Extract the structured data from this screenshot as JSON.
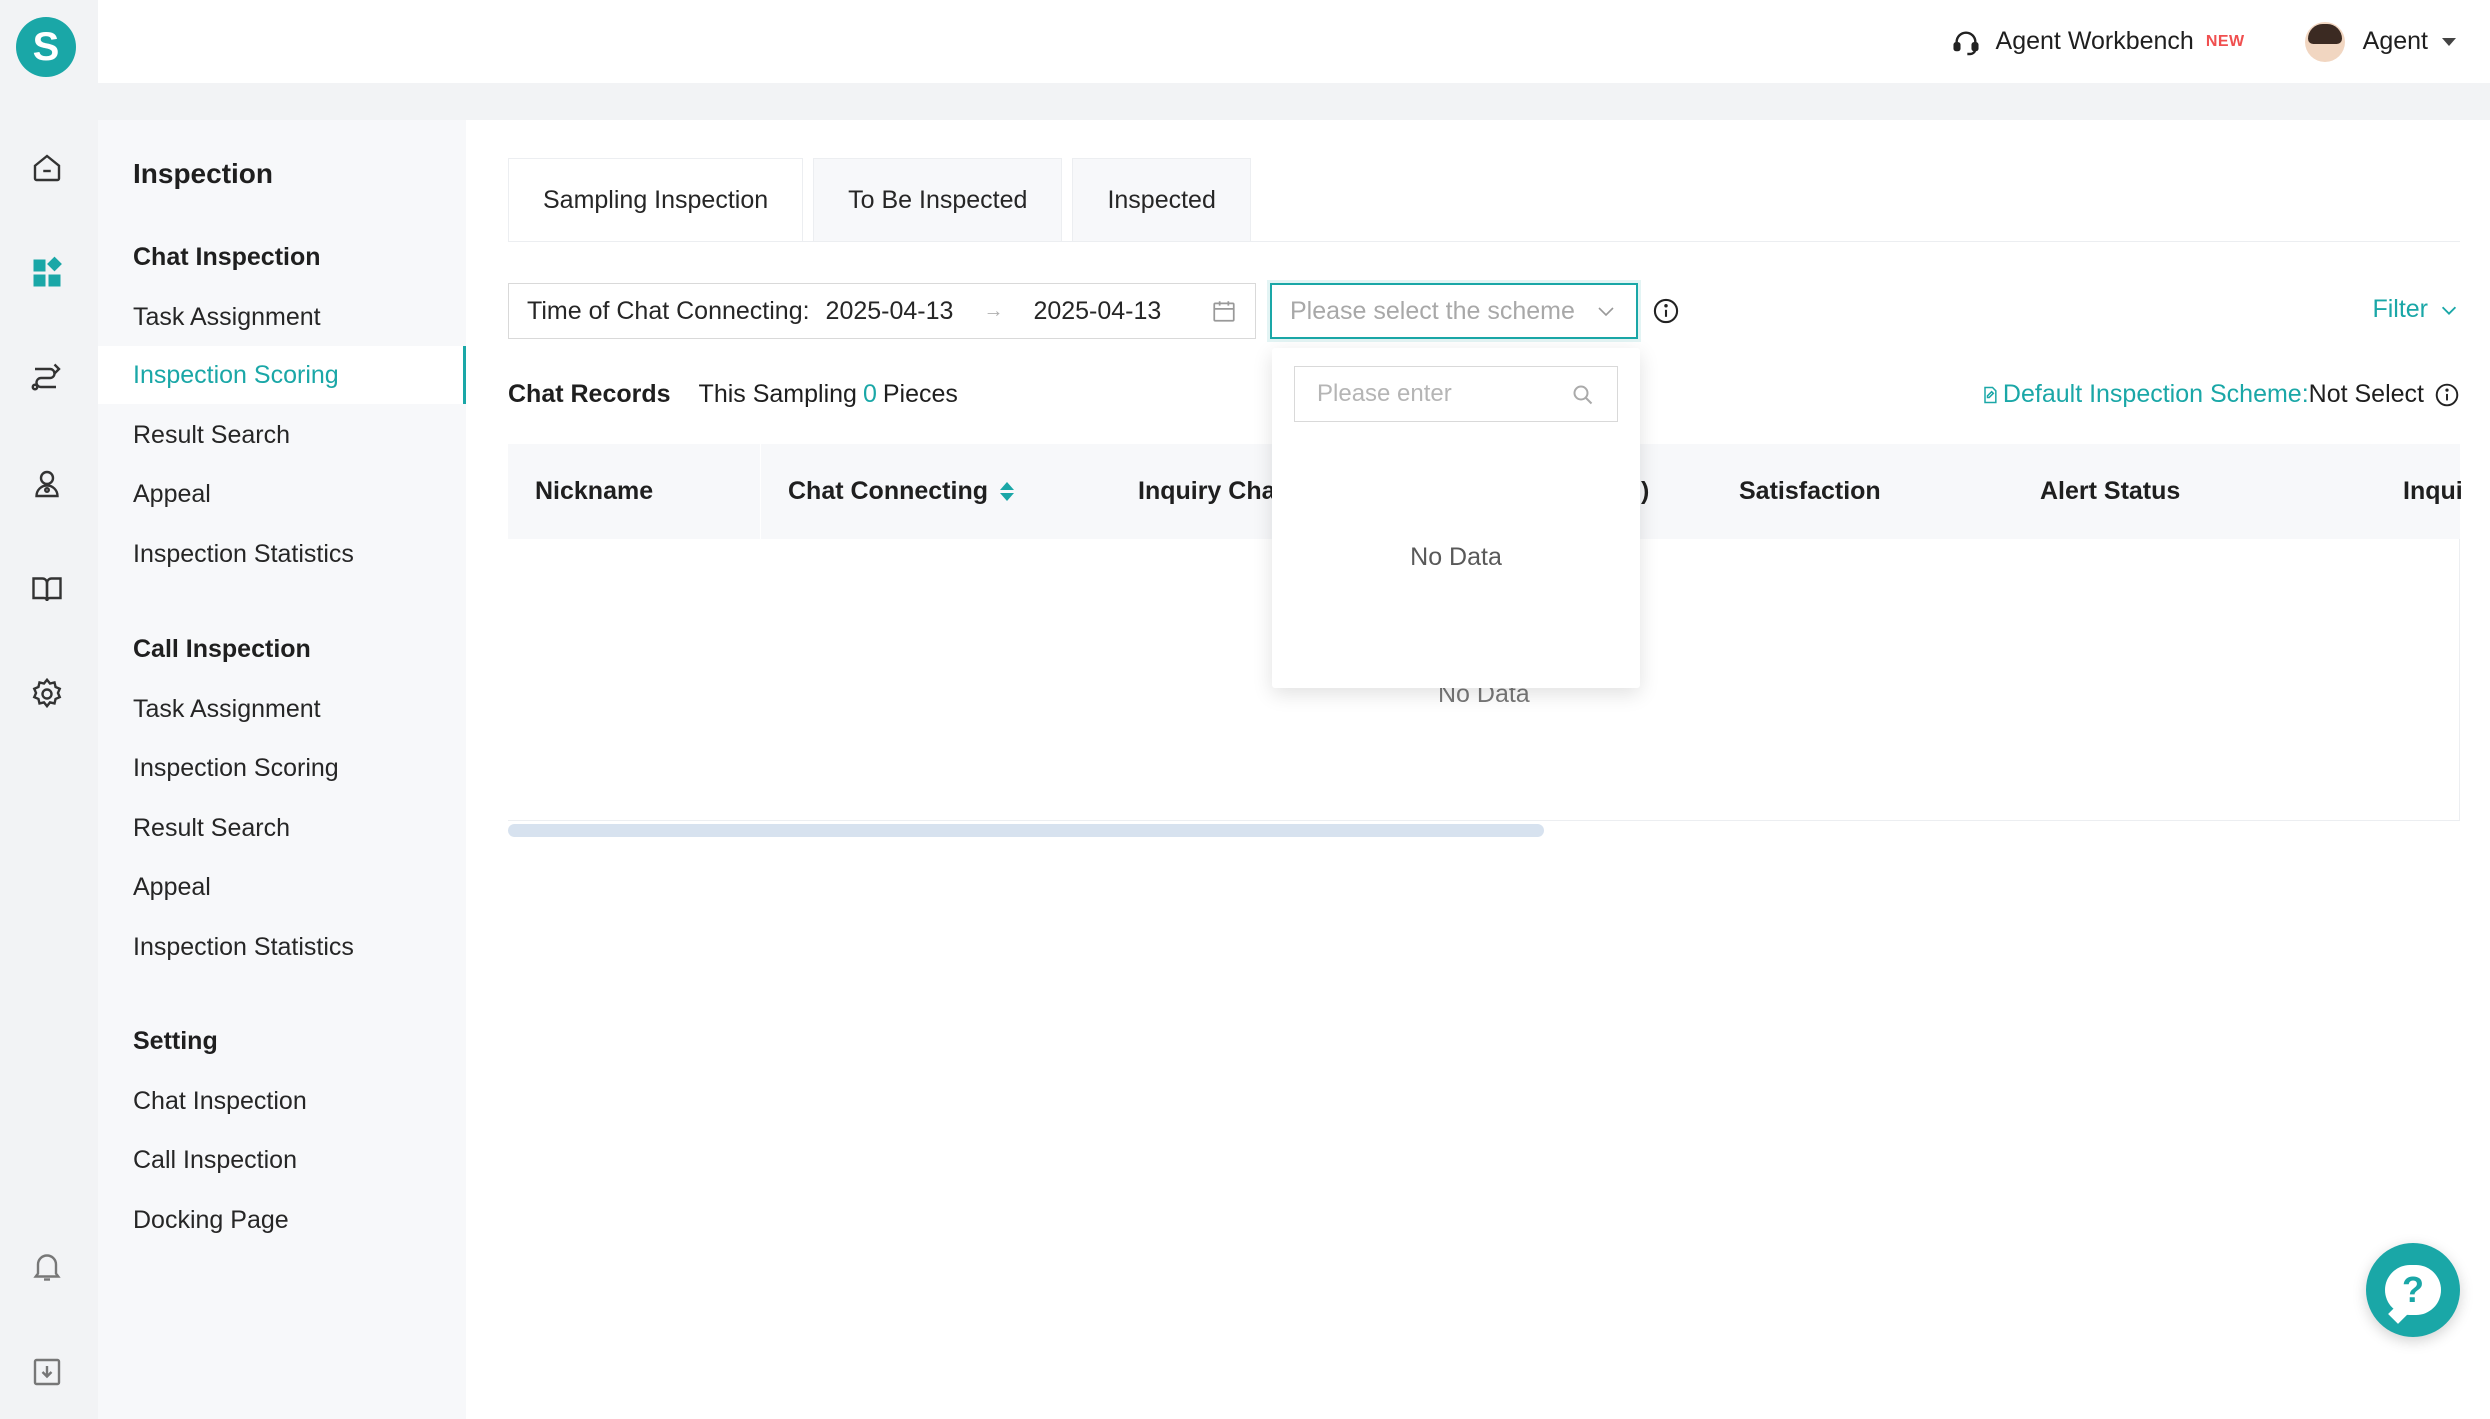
{
  "app": {
    "logo_letter": "S",
    "brand_color": "#1aa7a7"
  },
  "rail": {
    "icons": [
      "home-icon",
      "dashboard-icon",
      "routing-icon",
      "person-icon",
      "book-icon",
      "gear-icon",
      "bell-icon",
      "download-icon"
    ]
  },
  "header": {
    "workbench_label": "Agent Workbench",
    "new_badge": "NEW",
    "user_label": "Agent"
  },
  "menu": {
    "title": "Inspection",
    "groups": [
      {
        "label": "Chat Inspection",
        "items": [
          "Task Assignment",
          "Inspection Scoring",
          "Result Search",
          "Appeal",
          "Inspection Statistics"
        ]
      },
      {
        "label": "Call Inspection",
        "items": [
          "Task Assignment",
          "Inspection Scoring",
          "Result Search",
          "Appeal",
          "Inspection Statistics"
        ]
      },
      {
        "label": "Setting",
        "items": [
          "Chat Inspection",
          "Call Inspection",
          "Docking Page"
        ]
      }
    ],
    "active_item": "Inspection Scoring"
  },
  "tabs": [
    "Sampling Inspection",
    "To Be Inspected",
    "Inspected"
  ],
  "filters": {
    "date_label": "Time of Chat Connecting:",
    "date_start": "2025-04-13",
    "date_end": "2025-04-13",
    "date_separator": "→",
    "scheme_placeholder": "Please select the scheme",
    "filter_label": "Filter"
  },
  "records": {
    "title": "Chat Records",
    "prefix": "This Sampling",
    "count": "0",
    "suffix": "Pieces",
    "scheme_link": "Default Inspection Scheme:",
    "scheme_value": "Not Select"
  },
  "table": {
    "columns": [
      "Nickname",
      "Chat Connecting",
      "Inquiry Char",
      "Satisfaction",
      "Alert Status",
      "Inqui"
    ],
    "hidden_header_fragment": ")",
    "empty_text": "No Data"
  },
  "dropdown": {
    "search_placeholder": "Please enter",
    "empty_text": "No Data"
  },
  "help_fab": {
    "label": "?"
  }
}
